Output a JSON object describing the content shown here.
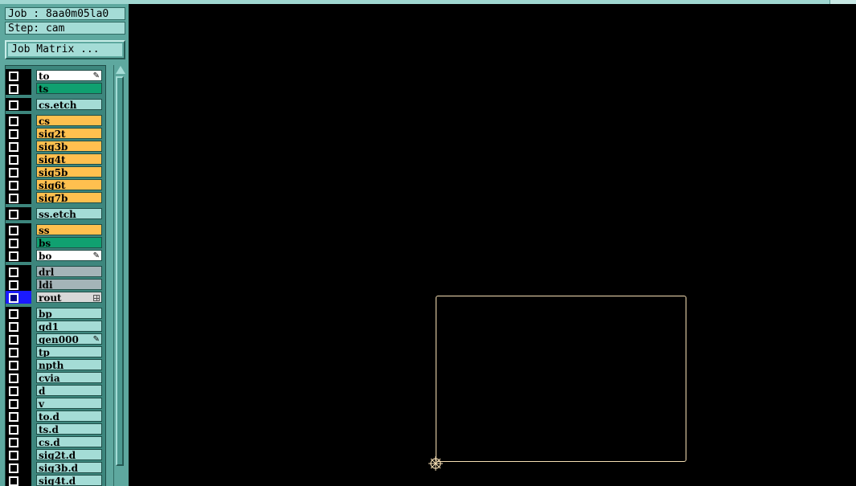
{
  "header": {
    "job_text": "Job : 8aa0m05la0",
    "step_text": "Step: cam",
    "job_matrix_label": "Job Matrix ..."
  },
  "layer_groups": [
    [
      {
        "name": "to",
        "color": "#ffffff",
        "icon": "edit-icon"
      },
      {
        "name": "ts",
        "color": "#10a070"
      }
    ],
    [
      {
        "name": "cs.etch",
        "color": "#a4dcd6"
      }
    ],
    [
      {
        "name": "cs",
        "color": "#ffc04f"
      },
      {
        "name": "sig2t",
        "color": "#ffc04f"
      },
      {
        "name": "sig3b",
        "color": "#ffc04f"
      },
      {
        "name": "sig4t",
        "color": "#ffc04f"
      },
      {
        "name": "sig5b",
        "color": "#ffc04f"
      },
      {
        "name": "sig6t",
        "color": "#ffc04f"
      },
      {
        "name": "sig7b",
        "color": "#ffc04f"
      }
    ],
    [
      {
        "name": "ss.etch",
        "color": "#a4dcd6"
      }
    ],
    [
      {
        "name": "ss",
        "color": "#ffc04f"
      },
      {
        "name": "bs",
        "color": "#10a070"
      },
      {
        "name": "bo",
        "color": "#ffffff",
        "icon": "edit-icon"
      }
    ],
    [
      {
        "name": "drl",
        "color": "#a4b4b8"
      },
      {
        "name": "ldi",
        "color": "#a4b4b8"
      },
      {
        "name": "rout",
        "color": "#d8d8d8",
        "icon": "grid-icon",
        "selected": true
      }
    ],
    [
      {
        "name": "bp",
        "color": "#a4dcd6"
      },
      {
        "name": "gd1",
        "color": "#a4dcd6"
      },
      {
        "name": "gen000",
        "color": "#a4dcd6",
        "icon": "edit-icon"
      },
      {
        "name": "tp",
        "color": "#a4dcd6"
      },
      {
        "name": "npth",
        "color": "#a4dcd6"
      },
      {
        "name": "cvia",
        "color": "#a4dcd6"
      },
      {
        "name": "d",
        "color": "#a4dcd6"
      },
      {
        "name": "v",
        "color": "#a4dcd6"
      },
      {
        "name": "to.d",
        "color": "#a4dcd6"
      },
      {
        "name": "ts.d",
        "color": "#a4dcd6"
      },
      {
        "name": "cs.d",
        "color": "#a4dcd6"
      },
      {
        "name": "sig2t.d",
        "color": "#a4dcd6"
      },
      {
        "name": "sig3b.d",
        "color": "#a4dcd6"
      },
      {
        "name": "sig4t.d",
        "color": "#a4dcd6"
      }
    ]
  ],
  "canvas": {
    "background": "#000000",
    "profile_color": "#f5deb3",
    "origin_marker": "origin-crosshair-icon"
  }
}
